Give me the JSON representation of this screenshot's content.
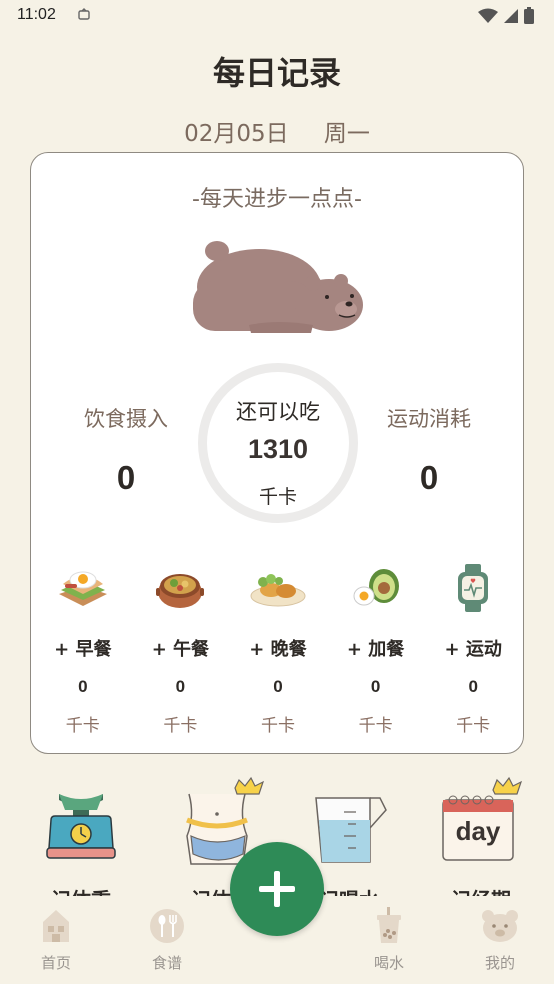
{
  "status": {
    "time": "11:02"
  },
  "header": {
    "title": "每日记录",
    "date": "02月05日",
    "weekday": "周一"
  },
  "card": {
    "slogan": "-每天进步一点点-",
    "intake": {
      "label": "饮食摄入",
      "value": "0"
    },
    "burned": {
      "label": "运动消耗",
      "value": "0"
    },
    "remaining": {
      "label": "还可以吃",
      "value": "1310",
      "unit": "千卡"
    },
    "meals": [
      {
        "label": "+ 早餐",
        "value": "0",
        "unit": "千卡",
        "icon": "breakfast-icon"
      },
      {
        "label": "+ 午餐",
        "value": "0",
        "unit": "千卡",
        "icon": "lunch-icon"
      },
      {
        "label": "+ 晚餐",
        "value": "0",
        "unit": "千卡",
        "icon": "dinner-icon"
      },
      {
        "label": "+ 加餐",
        "value": "0",
        "unit": "千卡",
        "icon": "snack-icon"
      },
      {
        "label": "+ 运动",
        "value": "0",
        "unit": "千卡",
        "icon": "exercise-icon"
      }
    ]
  },
  "tools": [
    {
      "label": "记体重",
      "icon": "scale-icon"
    },
    {
      "label": "记体围",
      "icon": "waist-icon"
    },
    {
      "label": "记喝水",
      "icon": "water-cup-icon"
    },
    {
      "label": "记经期",
      "icon": "calendar-day-icon",
      "icon_text": "day"
    }
  ],
  "tabbar": [
    {
      "label": "首页",
      "icon": "home-icon"
    },
    {
      "label": "食谱",
      "icon": "recipe-icon"
    },
    {
      "label": "喝水",
      "icon": "drink-icon"
    },
    {
      "label": "我的",
      "icon": "bear-profile-icon"
    }
  ],
  "colors": {
    "background": "#f6f2e6",
    "accent": "#2e8b57",
    "bear": "#a58580"
  }
}
